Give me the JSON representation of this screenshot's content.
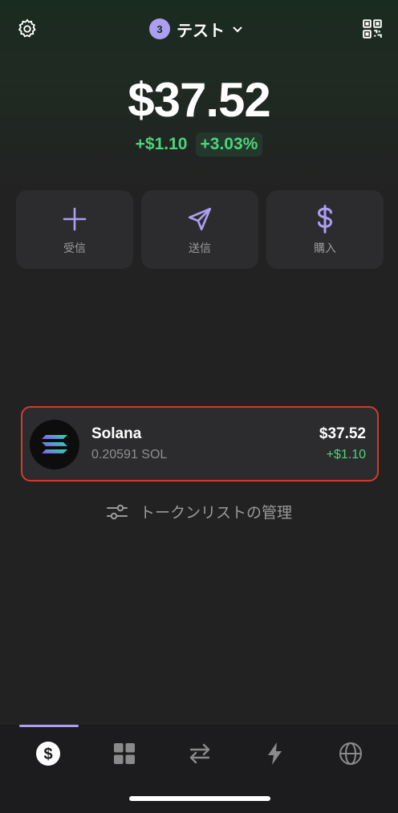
{
  "header": {
    "account_badge": "3",
    "account_name": "テスト",
    "icons": {
      "settings": "gear-icon",
      "qr": "qr-code-icon",
      "dropdown": "chevron-down-icon"
    }
  },
  "balance": {
    "total": "$37.52",
    "change_abs": "+$1.10",
    "change_pct": "+3.03%"
  },
  "actions": [
    {
      "label": "受信",
      "icon": "plus-icon"
    },
    {
      "label": "送信",
      "icon": "send-icon"
    },
    {
      "label": "購入",
      "icon": "dollar-icon"
    }
  ],
  "tokens": [
    {
      "name": "Solana",
      "amount": "0.20591 SOL",
      "value": "$37.52",
      "change": "+$1.10",
      "icon": "solana-logo-icon"
    }
  ],
  "manage_label": "トークンリストの管理",
  "tabbar": {
    "active": 0,
    "tabs": [
      {
        "icon": "dollar-circle-icon"
      },
      {
        "icon": "grid-icon"
      },
      {
        "icon": "swap-icon"
      },
      {
        "icon": "lightning-icon"
      },
      {
        "icon": "globe-icon"
      }
    ]
  },
  "colors": {
    "accent": "#ab9ff2",
    "positive": "#4bd57a",
    "highlight_border": "#d33b2c"
  }
}
